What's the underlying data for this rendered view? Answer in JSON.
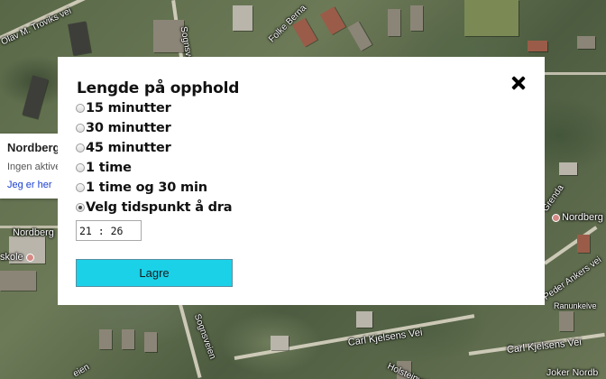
{
  "map": {
    "labels": {
      "olav_troviks": "Olav M. Troviks vei",
      "sognsveien_top": "Sognsveien",
      "folke_bernadottes": "Folke Berna",
      "nordberg_left": "Nordberg",
      "skole": "skole",
      "nordberg_right": "Nordberg",
      "grenda": "Grenda",
      "peder_ankers": "Peder Ankers vei",
      "ranunkelveien": "Ranunkelve",
      "sognsveien_bottom": "Sognsveien",
      "carl_kjelsens_center": "Carl Kjelsens Vei",
      "carl_kjelsens_right": "Carl Kjelsens Vei",
      "holsteinveien": "Holsteinveien",
      "joker_nordberg": "Joker Nordb",
      "bottom_left_vei": "eien"
    }
  },
  "info_panel": {
    "title": "Nordberg",
    "status": "Ingen aktive",
    "link": "Jeg er her"
  },
  "modal": {
    "title": "Lengde på opphold",
    "close_icon": "close-icon",
    "options": [
      {
        "label": "15 minutter",
        "checked": false
      },
      {
        "label": "30 minutter",
        "checked": false
      },
      {
        "label": "45 minutter",
        "checked": false
      },
      {
        "label": "1 time",
        "checked": false
      },
      {
        "label": "1 time og 30 min",
        "checked": false
      },
      {
        "label": "Velg tidspunkt å dra",
        "checked": true
      }
    ],
    "time_value": "21 : 26",
    "save_label": "Lagre"
  },
  "colors": {
    "save_button": "#1ad1e8",
    "modal_bg": "#ffffff",
    "link": "#1a3fcf"
  }
}
